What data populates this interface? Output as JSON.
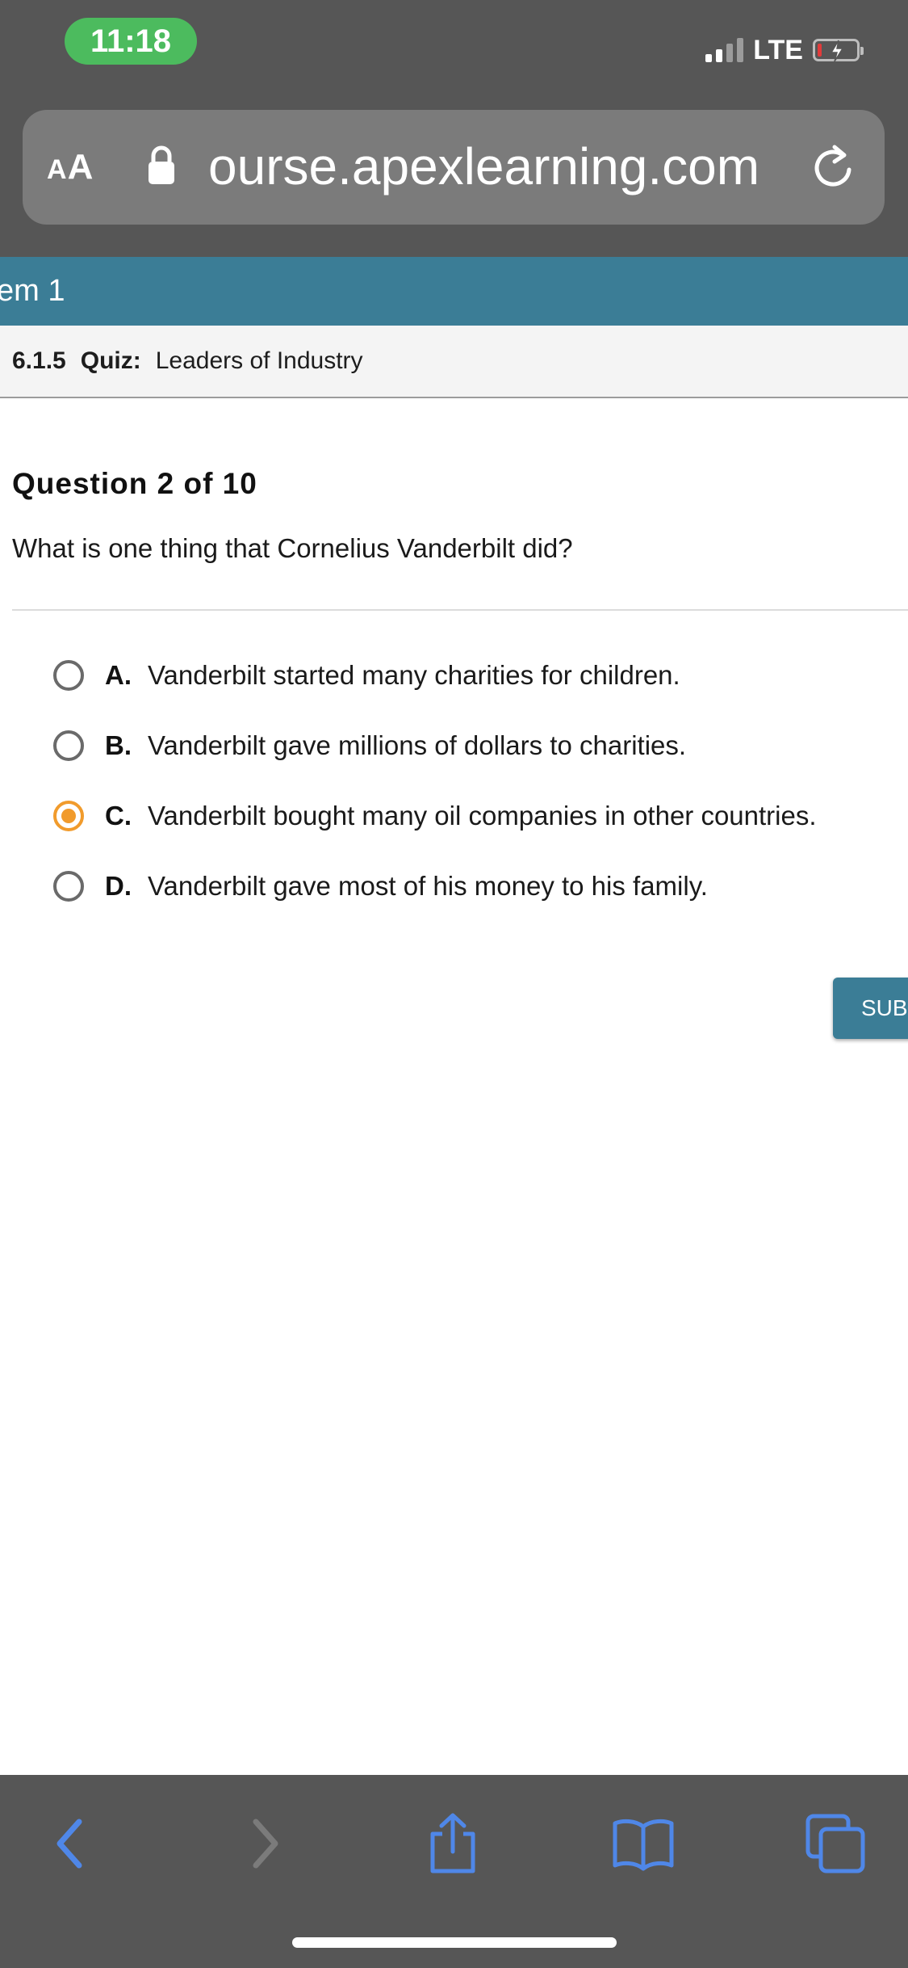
{
  "status_bar": {
    "time": "11:18",
    "network": "LTE",
    "time_pill_color": "#4cbb5e"
  },
  "browser": {
    "text_size_label": "AA",
    "url": "ourse.apexlearning.com"
  },
  "page": {
    "unit_label": "em 1",
    "quiz_number": "6.1.5",
    "quiz_kind": "Quiz:",
    "quiz_name": "Leaders of Industry",
    "question_number": "Question 2 of 10",
    "question_text": "What is one thing that Cornelius Vanderbilt did?",
    "options": [
      {
        "letter": "A.",
        "text": "Vanderbilt started many charities for children.",
        "selected": false
      },
      {
        "letter": "B.",
        "text": "Vanderbilt gave millions of dollars to charities.",
        "selected": false
      },
      {
        "letter": "C.",
        "text": "Vanderbilt bought many oil companies in other countries.",
        "selected": true
      },
      {
        "letter": "D.",
        "text": "Vanderbilt gave most of his money to his family.",
        "selected": false
      }
    ],
    "submit_label": "SUB"
  },
  "colors": {
    "accent": "#3b7d96",
    "selected_radio": "#f19b2c",
    "toolbar_icon": "#4f87e8"
  },
  "toolbar_icons": [
    "back-icon",
    "forward-icon",
    "share-icon",
    "bookmarks-icon",
    "tabs-icon"
  ]
}
